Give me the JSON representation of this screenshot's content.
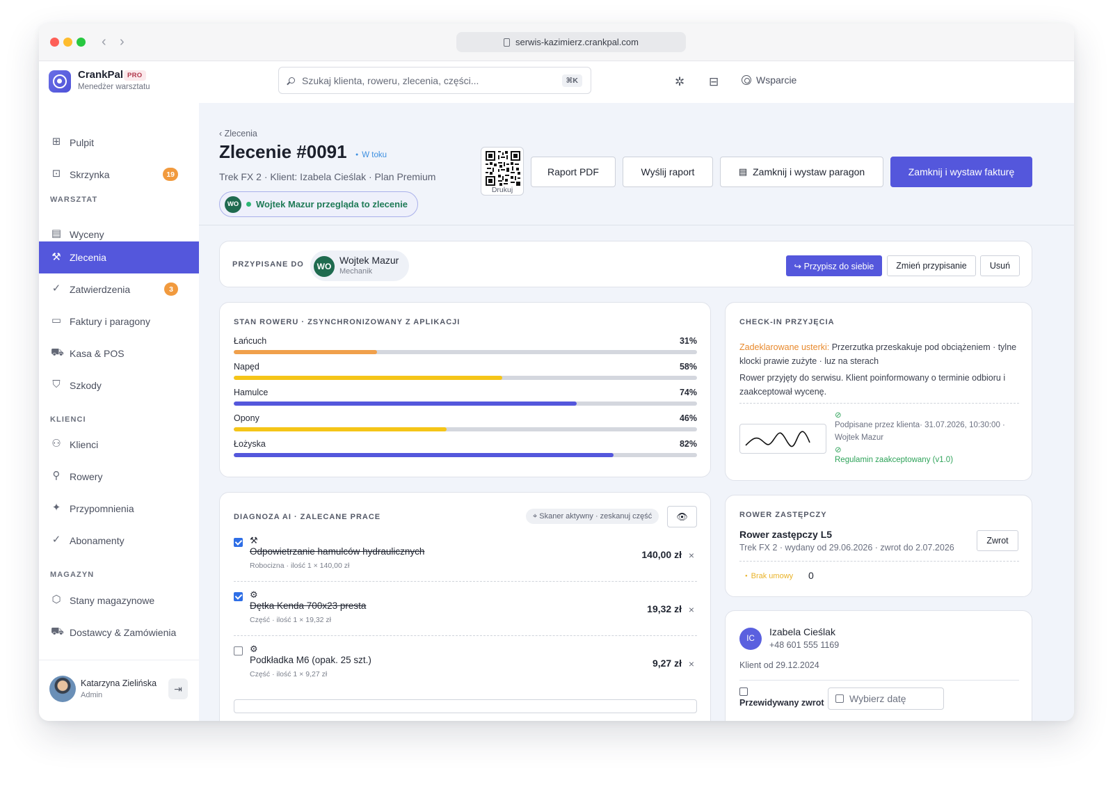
{
  "browser": {
    "url": "serwis-kazimierz.crankpal.com"
  },
  "brand": {
    "name": "CrankPal",
    "badge": "PRO",
    "subtitle": "Menedżer warsztatu"
  },
  "search": {
    "placeholder": "Szukaj klienta, roweru, zlecenia, części...",
    "shortcut": "⌘K"
  },
  "top": {
    "support_label": "Wsparcie"
  },
  "sidebar": {
    "items": [
      {
        "label": "Pulpit",
        "icon": "grid-icon"
      },
      {
        "label": "Skrzynka",
        "icon": "inbox-icon",
        "badge": "19"
      }
    ],
    "sections": {
      "warsztat": "WARSZTAT",
      "klienci": "KLIENCI",
      "magazyn": "MAGAZYN"
    },
    "warsztat_items": [
      {
        "label": "Wyceny",
        "icon": "document-icon"
      },
      {
        "label": "Zlecenia",
        "icon": "wrench-icon",
        "active": true
      },
      {
        "label": "Zatwierdzenia",
        "icon": "check-circle-icon",
        "badge": "3"
      },
      {
        "label": "Faktury i paragony",
        "icon": "receipt-icon"
      },
      {
        "label": "Kasa & POS",
        "icon": "cart-icon"
      },
      {
        "label": "Szkody",
        "icon": "shield-icon"
      }
    ],
    "klienci_items": [
      {
        "label": "Klienci",
        "icon": "users-icon"
      },
      {
        "label": "Rowery",
        "icon": "bike-icon"
      },
      {
        "label": "Przypomnienia",
        "icon": "sparkle-icon"
      },
      {
        "label": "Abonamenty",
        "icon": "check-circle-icon"
      }
    ],
    "magazyn_items": [
      {
        "label": "Stany magazynowe",
        "icon": "box-icon"
      },
      {
        "label": "Dostawcy & Zamówienia",
        "icon": "truck-icon"
      }
    ],
    "user": {
      "name": "Katarzyna Zielińska",
      "role": "Admin"
    }
  },
  "header": {
    "breadcrumb": "‹ Zlecenia",
    "title": "Zlecenie #0091",
    "status": "W toku",
    "subtitle": "Trek FX 2 · Klient: Izabela Cieślak · Plan Premium",
    "viewer_initials": "WO",
    "viewer_text": "Wojtek Mazur przegląda to zlecenie",
    "qr_label": "Drukuj",
    "buttons": {
      "pdf": "Raport PDF",
      "send": "Wyślij raport",
      "receipt": "Zamknij i wystaw paragon",
      "invoice": "Zamknij i wystaw fakturę"
    }
  },
  "assignment": {
    "label": "PRZYPISANE DO",
    "initials": "WO",
    "name": "Wojtek Mazur",
    "role": "Mechanik",
    "assign_self": "↪ Przypisz do siebie",
    "change": "Zmień przypisanie",
    "remove": "Usuń"
  },
  "condition": {
    "label": "STAN ROWERU · ZSYNCHRONIZOWANY Z APLIKACJI",
    "bars": [
      {
        "name": "Łańcuch",
        "pct_label": "31%",
        "value": 31,
        "color": "#f0a04b"
      },
      {
        "name": "Napęd",
        "pct_label": "58%",
        "value": 58,
        "color": "#f5c518"
      },
      {
        "name": "Hamulce",
        "pct_label": "74%",
        "value": 74,
        "color": "#5457dc"
      },
      {
        "name": "Opony",
        "pct_label": "46%",
        "value": 46,
        "color": "#f5c518"
      },
      {
        "name": "Łożyska",
        "pct_label": "82%",
        "value": 82,
        "color": "#5457dc"
      }
    ]
  },
  "checkin": {
    "label": "CHECK-IN PRZYJĘCIA",
    "declared_label": "Zadeklarowane usterki:",
    "declared_text": " Przerzutka przeskakuje pod obciążeniem · tylne klocki prawie zużyte · luz na sterach",
    "note": "Rower przyjęty do serwisu. Klient poinformowany o terminie odbioru i zaakceptował wycenę.",
    "signed": "Podpisane przez klienta· 31.07.2026, 10:30:00 · Wojtek Mazur",
    "terms": "Regulamin zaakceptowany (v1.0)"
  },
  "diagnosis": {
    "label": "DIAGNOZA AI · ZALECANE PRACE",
    "scanner": "⌖ Skaner aktywny · zeskanuj część",
    "jobs": [
      {
        "icon": "wrench-icon",
        "glyph": "⚒",
        "title": "Odpowietrzanie hamulców hydraulicznych",
        "meta": "Robocizna · ilość 1 × 140,00 zł",
        "price": "140,00 zł",
        "checked": true
      },
      {
        "icon": "gear-icon",
        "glyph": "⚙",
        "title": "Dętka Kenda 700x23 presta",
        "meta": "Część · ilość 1 × 19,32 zł",
        "price": "19,32 zł",
        "checked": true
      },
      {
        "icon": "gear-icon",
        "glyph": "⚙",
        "title": "Podkładka M6 (opak. 25 szt.)",
        "meta": "Część · ilość 1 × 9,27 zł",
        "price": "9,27 zł",
        "checked": false
      }
    ]
  },
  "replacement": {
    "label": "ROWER ZASTĘPCZY",
    "title": "Rower zastępczy L5",
    "subtitle": "Trek FX 2 · wydany od 29.06.2026 · zwrot do 2.07.2026",
    "return_button": "Zwrot",
    "contract_status": "Brak umowy",
    "count": "0"
  },
  "customer": {
    "initials": "IC",
    "name": "Izabela Cieślak",
    "phone": "+48 601 555 1169",
    "since": "Klient od 29.12.2024",
    "return_label": "Przewidywany zwrot",
    "date_placeholder": "Wybierz datę"
  },
  "colors": {
    "accent": "#5457dc",
    "badge": "#f19a3e",
    "success": "#2fa35a",
    "warning": "#e8892c"
  }
}
